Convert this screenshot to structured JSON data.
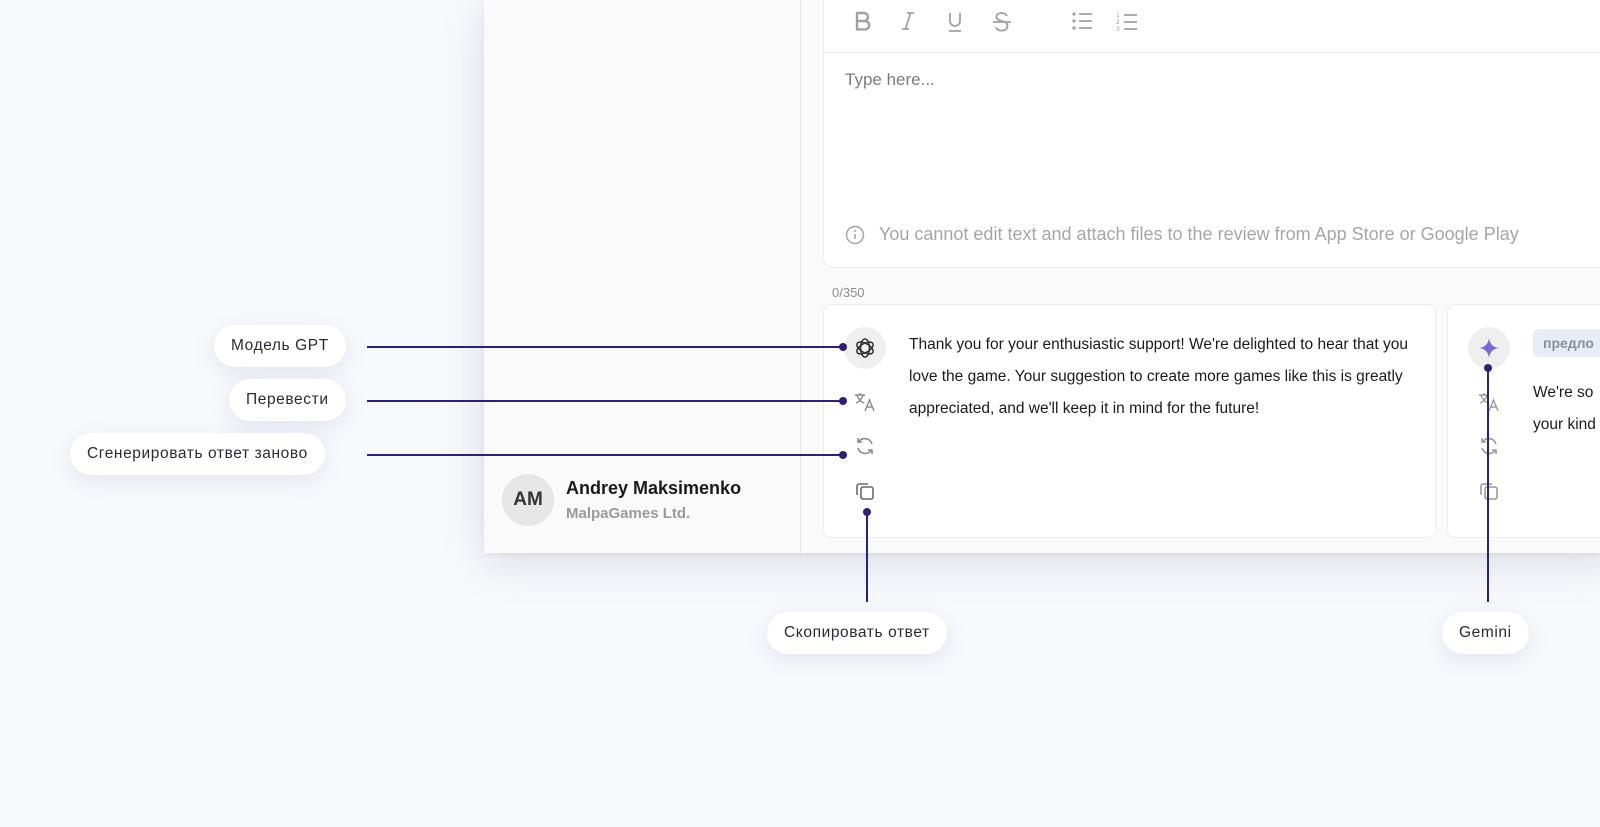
{
  "toolbar": {
    "icons": [
      "bold-icon",
      "italic-icon",
      "underline-icon",
      "strikethrough-icon",
      "bullet-list-icon",
      "numbered-list-icon"
    ]
  },
  "editor": {
    "placeholder": "Type here...",
    "notice": "You cannot edit text and attach files to the review from App Store or Google Play",
    "counter": "0/350"
  },
  "user": {
    "initials": "AM",
    "name": "Andrey Maksimenko",
    "company": "MalpaGames Ltd."
  },
  "answers": [
    {
      "model_icon": "openai-icon",
      "text": "Thank you for your enthusiastic support! We're delighted to hear that you love the game. Your suggestion to create more games like this is greatly appreciated, and we'll keep it in mind for the future!"
    },
    {
      "model_icon": "gemini-sparkle-icon",
      "tag": "предло",
      "text_line1": "We're so",
      "text_line2": "your kind"
    }
  ],
  "callouts": {
    "gpt_model": "Модель GPT",
    "translate": "Перевести",
    "regenerate": "Сгенерировать ответ заново",
    "copy": "Скопировать ответ",
    "gemini": "Gemini"
  },
  "colors": {
    "callout_line": "#2b2175",
    "gemini_accent": "#7b6ad6",
    "background": "#f8f9fd"
  }
}
